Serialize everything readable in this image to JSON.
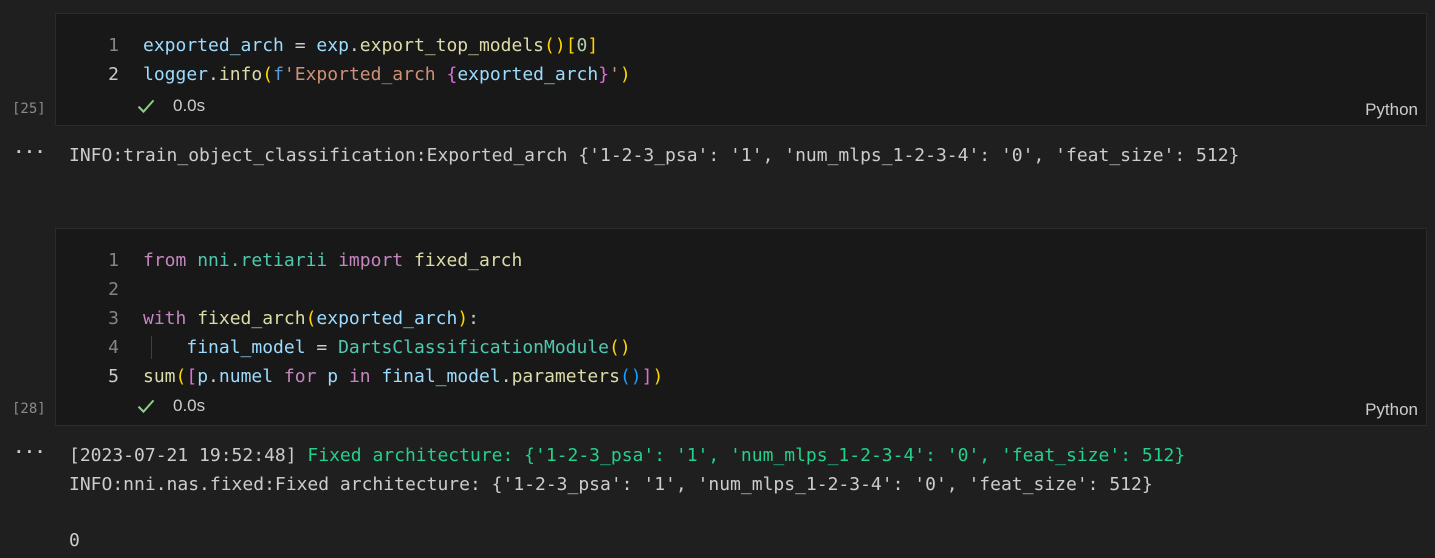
{
  "cells": [
    {
      "exec_count": "[25]",
      "duration": "0.0s",
      "language": "Python",
      "lines": [
        {
          "n": "1",
          "tokens": [
            {
              "t": "exported_arch",
              "c": "var"
            },
            {
              "t": " = ",
              "c": ""
            },
            {
              "t": "exp",
              "c": "var"
            },
            {
              "t": ".",
              "c": ""
            },
            {
              "t": "export_top_models",
              "c": "fn"
            },
            {
              "t": "()",
              "c": "b1"
            },
            {
              "t": "[",
              "c": "b1"
            },
            {
              "t": "0",
              "c": "num"
            },
            {
              "t": "]",
              "c": "b1"
            }
          ]
        },
        {
          "n": "2",
          "tokens": [
            {
              "t": "logger",
              "c": "var"
            },
            {
              "t": ".",
              "c": ""
            },
            {
              "t": "info",
              "c": "fn"
            },
            {
              "t": "(",
              "c": "b1"
            },
            {
              "t": "f",
              "c": "kwb"
            },
            {
              "t": "'Exported_arch ",
              "c": "str"
            },
            {
              "t": "{",
              "c": "b2"
            },
            {
              "t": "exported_arch",
              "c": "var"
            },
            {
              "t": "}",
              "c": "b2"
            },
            {
              "t": "'",
              "c": "str"
            },
            {
              "t": ")",
              "c": "b1"
            }
          ]
        }
      ],
      "outputs": [
        {
          "segments": [
            {
              "t": "INFO:train_object_classification:Exported_arch {'1-2-3_psa': '1', 'num_mlps_1-2-3-4': '0', 'feat_size': 512}",
              "c": ""
            }
          ]
        }
      ]
    },
    {
      "exec_count": "[28]",
      "duration": "0.0s",
      "language": "Python",
      "lines": [
        {
          "n": "1",
          "tokens": [
            {
              "t": "from",
              "c": "kw"
            },
            {
              "t": " ",
              "c": ""
            },
            {
              "t": "nni.retiarii",
              "c": "cls"
            },
            {
              "t": " ",
              "c": ""
            },
            {
              "t": "import",
              "c": "kw"
            },
            {
              "t": " ",
              "c": ""
            },
            {
              "t": "fixed_arch",
              "c": "fn"
            }
          ]
        },
        {
          "n": "2",
          "tokens": []
        },
        {
          "n": "3",
          "tokens": [
            {
              "t": "with",
              "c": "kw"
            },
            {
              "t": " ",
              "c": ""
            },
            {
              "t": "fixed_arch",
              "c": "fn"
            },
            {
              "t": "(",
              "c": "b1"
            },
            {
              "t": "exported_arch",
              "c": "var"
            },
            {
              "t": ")",
              "c": "b1"
            },
            {
              "t": ":",
              "c": ""
            }
          ]
        },
        {
          "n": "4",
          "indent": true,
          "tokens": [
            {
              "t": "    ",
              "c": ""
            },
            {
              "t": "final_model",
              "c": "var"
            },
            {
              "t": " = ",
              "c": ""
            },
            {
              "t": "DartsClassificationModule",
              "c": "cls"
            },
            {
              "t": "()",
              "c": "b1"
            }
          ]
        },
        {
          "n": "5",
          "tokens": [
            {
              "t": "sum",
              "c": "fn"
            },
            {
              "t": "(",
              "c": "b1"
            },
            {
              "t": "[",
              "c": "b2"
            },
            {
              "t": "p",
              "c": "var"
            },
            {
              "t": ".",
              "c": ""
            },
            {
              "t": "numel",
              "c": "var"
            },
            {
              "t": " ",
              "c": ""
            },
            {
              "t": "for",
              "c": "kw"
            },
            {
              "t": " ",
              "c": ""
            },
            {
              "t": "p",
              "c": "var"
            },
            {
              "t": " ",
              "c": ""
            },
            {
              "t": "in",
              "c": "kw"
            },
            {
              "t": " ",
              "c": ""
            },
            {
              "t": "final_model",
              "c": "var"
            },
            {
              "t": ".",
              "c": ""
            },
            {
              "t": "parameters",
              "c": "fn"
            },
            {
              "t": "()",
              "c": "b3"
            },
            {
              "t": "]",
              "c": "b2"
            },
            {
              "t": ")",
              "c": "b1"
            }
          ]
        }
      ],
      "outputs": [
        {
          "segments": [
            {
              "t": "[2023-07-21 19:52:48] ",
              "c": ""
            },
            {
              "t": "Fixed architecture: {'1-2-3_psa': '1', 'num_mlps_1-2-3-4': '0', 'feat_size': 512}",
              "c": "grn"
            }
          ]
        },
        {
          "segments": [
            {
              "t": "INFO:nni.nas.fixed:Fixed architecture: {'1-2-3_psa': '1', 'num_mlps_1-2-3-4': '0', 'feat_size': 512}",
              "c": ""
            }
          ]
        },
        {
          "segments": []
        },
        {
          "segments": [
            {
              "t": "0",
              "c": ""
            }
          ]
        }
      ]
    }
  ],
  "output_ellipsis": "···",
  "icons": {
    "check": "check-icon"
  },
  "colors": {
    "success": "#89d185",
    "background": "#1f1f1f",
    "cell_background": "#181818"
  }
}
